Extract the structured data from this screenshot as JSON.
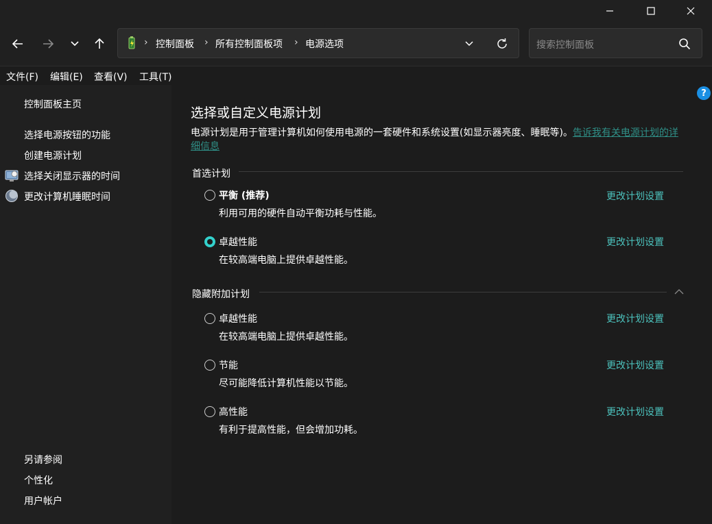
{
  "window": {
    "minimize_icon": "minimize-icon",
    "maximize_icon": "maximize-icon",
    "close_icon": "close-icon"
  },
  "nav": {
    "back_icon": "arrow-left-icon",
    "forward_icon": "arrow-right-icon",
    "recent_icon": "chevron-down-icon",
    "up_icon": "arrow-up-icon",
    "address_icon": "power-options-icon",
    "breadcrumbs": [
      "控制面板",
      "所有控制面板项",
      "电源选项"
    ],
    "search_placeholder": "搜索控制面板"
  },
  "menu": {
    "items": [
      "文件(F)",
      "编辑(E)",
      "查看(V)",
      "工具(T)"
    ]
  },
  "sidebar": {
    "home": "控制面板主页",
    "links": [
      "选择电源按钮的功能",
      "创建电源计划",
      "选择关闭显示器的时间",
      "更改计算机睡眠时间"
    ],
    "see_also_title": "另请参阅",
    "see_also": [
      "个性化",
      "用户帐户"
    ]
  },
  "main": {
    "title": "选择或自定义电源计划",
    "description": "电源计划是用于管理计算机如何使用电源的一套硬件和系统设置(如显示器亮度、睡眠等)。",
    "description_link": "告诉我有关电源计划的详细信息",
    "preferred_heading": "首选计划",
    "hidden_heading": "隐藏附加计划",
    "change_link": "更改计划设置",
    "preferred_plans": [
      {
        "name": "平衡 (推荐)",
        "desc": "利用可用的硬件自动平衡功耗与性能。",
        "selected": false
      },
      {
        "name": "卓越性能",
        "desc": "在较高端电脑上提供卓越性能。",
        "selected": true
      }
    ],
    "hidden_plans": [
      {
        "name": "卓越性能",
        "desc": "在较高端电脑上提供卓越性能。",
        "selected": false
      },
      {
        "name": "节能",
        "desc": "尽可能降低计算机性能以节能。",
        "selected": false
      },
      {
        "name": "高性能",
        "desc": "有利于提高性能，但会增加功耗。",
        "selected": false
      }
    ],
    "help_label": "?"
  },
  "colors": {
    "accent": "#33d1cc",
    "link": "#4cc2bd",
    "link_muted": "#2f8f87",
    "background": "#1c1c1c",
    "sidebar": "#202020"
  }
}
